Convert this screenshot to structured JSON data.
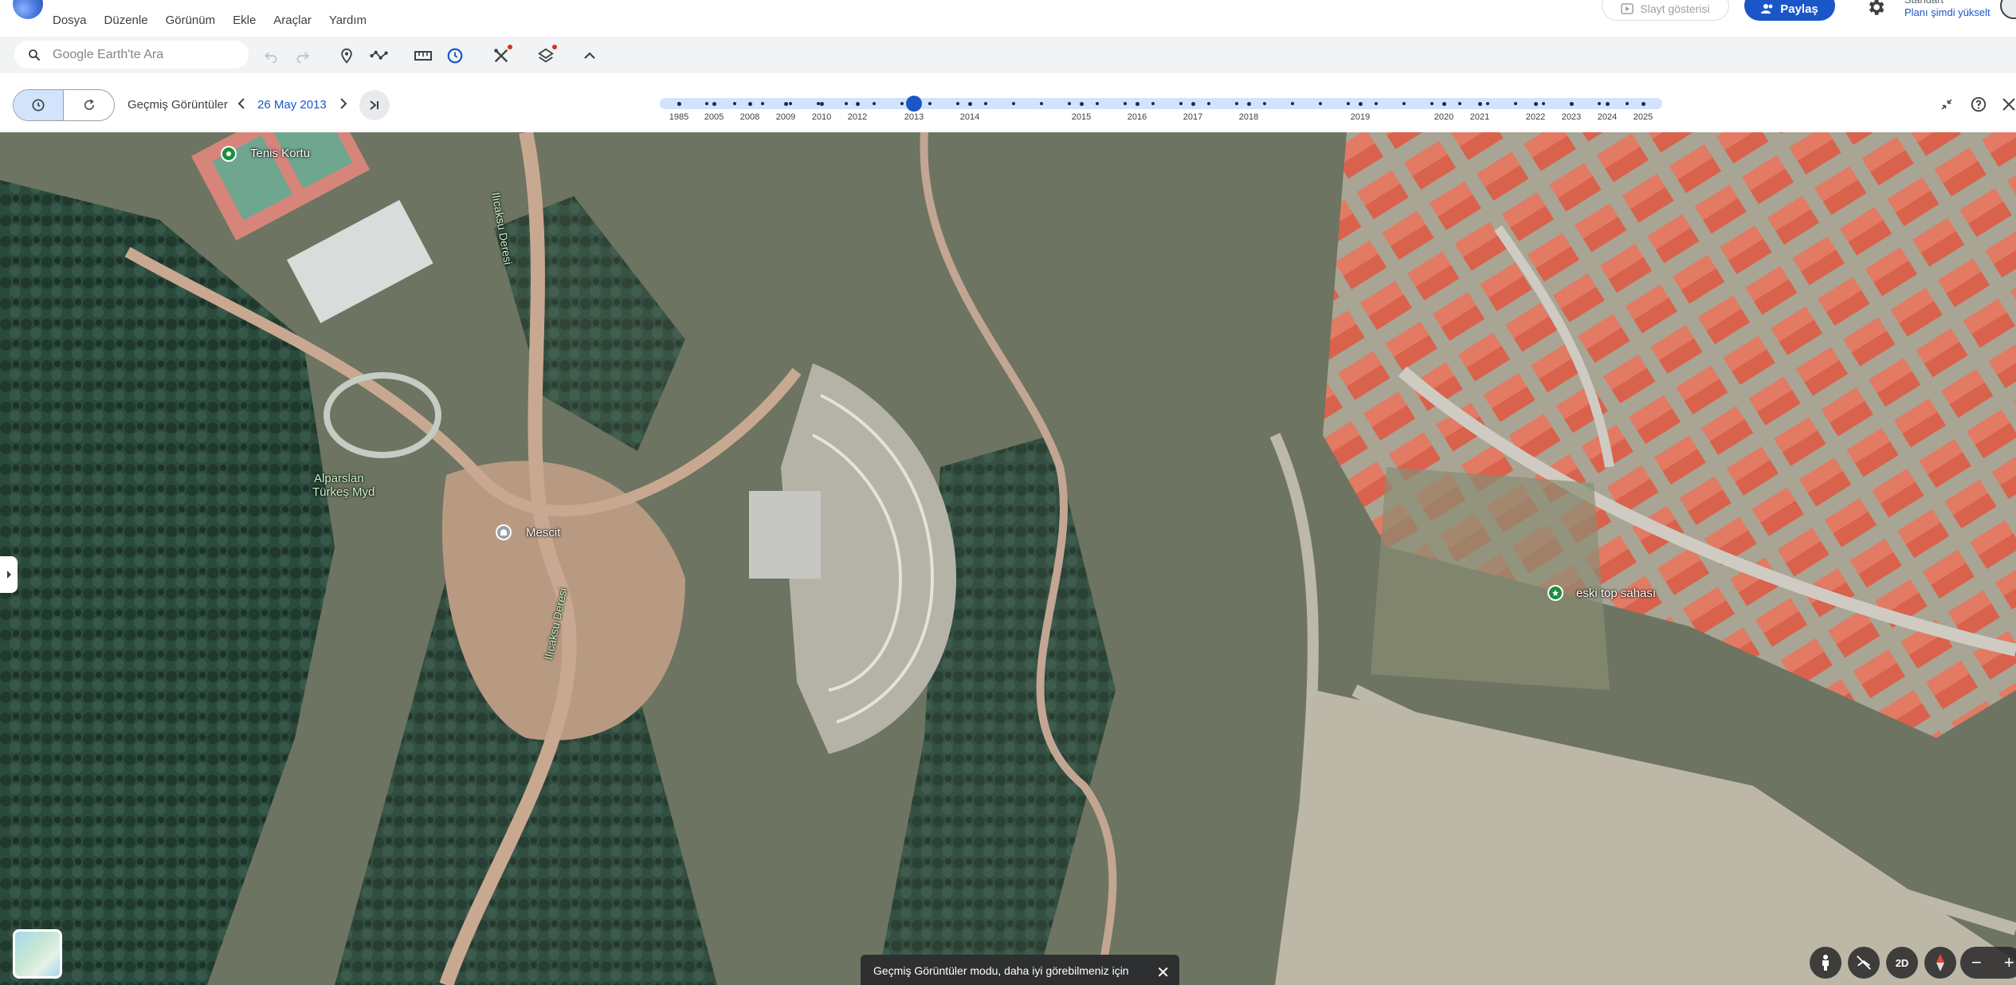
{
  "menu": {
    "items": [
      "Dosya",
      "Düzenle",
      "Görünüm",
      "Ekle",
      "Araçlar",
      "Yardım"
    ],
    "slideshow_label": "Slayt gösterisi",
    "share_label": "Paylaş",
    "plan_label": "Standart",
    "upgrade_label": "Planı şimdi yükselt"
  },
  "toolbar": {
    "search_placeholder": "Google Earth'te Ara",
    "icons": [
      "undo-icon",
      "redo-icon",
      "placemark-icon",
      "path-icon",
      "ruler-icon",
      "historical-imagery-icon",
      "tools-icon",
      "layers-icon",
      "collapse-icon"
    ]
  },
  "history": {
    "label": "Geçmiş Görüntüler",
    "current_date": "26 May 2013",
    "years": [
      "1985",
      "2005",
      "2008",
      "2009",
      "2010",
      "2012",
      "2013",
      "2014",
      "2015",
      "2016",
      "2017",
      "2018",
      "2019",
      "2020",
      "2021",
      "2022",
      "2023",
      "2024",
      "2025"
    ],
    "selected_year": "2013"
  },
  "map": {
    "labels": {
      "tennis": "Tenis Kortu",
      "alparslan_line1": "Alparslan",
      "alparslan_line2": "Türkeş Myd",
      "mosque": "Mescit",
      "creek_top": "Ilıcaksu Deresi",
      "creek_bottom": "Ilıcaksu Deresi",
      "field": "eski top sahası"
    },
    "toast": "Geçmiş Görüntüler modu, daha iyi görebilmeniz için",
    "view_mode": "2D"
  },
  "colors": {
    "accent": "#1a56c8",
    "timeline_track": "#d2e3fc",
    "roof": "#d9624d",
    "vegetation": "#2f4a3a",
    "dirt": "#b89a82"
  }
}
